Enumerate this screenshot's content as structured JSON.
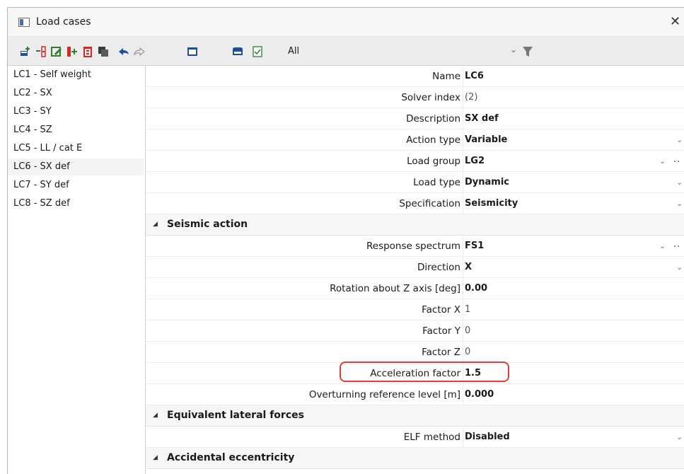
{
  "window": {
    "title": "Load cases",
    "close_glyph": "✕"
  },
  "toolbar": {
    "icons": [
      "new-load-case-icon",
      "insert-load-case-icon",
      "edit-icon",
      "copy-icon",
      "delete-icon",
      "duplicate-icon",
      "undo-icon",
      "redo-icon",
      "table-icon",
      "save-icon",
      "check-icon"
    ],
    "filter_value": "All",
    "dropdown_glyph": "⌄"
  },
  "load_cases": [
    {
      "label": "LC1 - Self weight"
    },
    {
      "label": "LC2 - SX"
    },
    {
      "label": "LC3 - SY"
    },
    {
      "label": "LC4 - SZ"
    },
    {
      "label": "LC5 - LL / cat E"
    },
    {
      "label": "LC6 - SX def",
      "selected": true
    },
    {
      "label": "LC7 - SY def"
    },
    {
      "label": "LC8 - SZ def"
    }
  ],
  "properties": {
    "name": {
      "label": "Name",
      "value": "LC6"
    },
    "solver_index": {
      "label": "Solver index",
      "value": "(2)"
    },
    "description": {
      "label": "Description",
      "value": "SX def"
    },
    "action_type": {
      "label": "Action type",
      "value": "Variable"
    },
    "load_group": {
      "label": "Load group",
      "value": "LG2"
    },
    "load_type": {
      "label": "Load type",
      "value": "Dynamic"
    },
    "specification": {
      "label": "Specification",
      "value": "Seismicity"
    }
  },
  "seismic": {
    "title": "Seismic action",
    "response_spectrum": {
      "label": "Response spectrum",
      "value": "FS1"
    },
    "direction": {
      "label": "Direction",
      "value": "X"
    },
    "rotation": {
      "label": "Rotation about Z axis [deg]",
      "value": "0.00"
    },
    "factor_x": {
      "label": "Factor X",
      "value": "1"
    },
    "factor_y": {
      "label": "Factor Y",
      "value": "0"
    },
    "factor_z": {
      "label": "Factor Z",
      "value": "0"
    },
    "acceleration": {
      "label": "Acceleration factor",
      "value": "1.5"
    },
    "overturning": {
      "label": "Overturning reference level [m]",
      "value": "0.000"
    }
  },
  "elf": {
    "title": "Equivalent lateral forces",
    "method": {
      "label": "ELF method",
      "value": "Disabled"
    }
  },
  "accidental": {
    "title": "Accidental eccentricity"
  },
  "glyphs": {
    "chevron": "⌄",
    "dots": "..",
    "collapse": "◢"
  },
  "colors": {
    "highlight": "#e23b3b",
    "accent_red": "#d62828",
    "accent_green": "#2e7d32",
    "accent_blue": "#1a4f9c"
  }
}
